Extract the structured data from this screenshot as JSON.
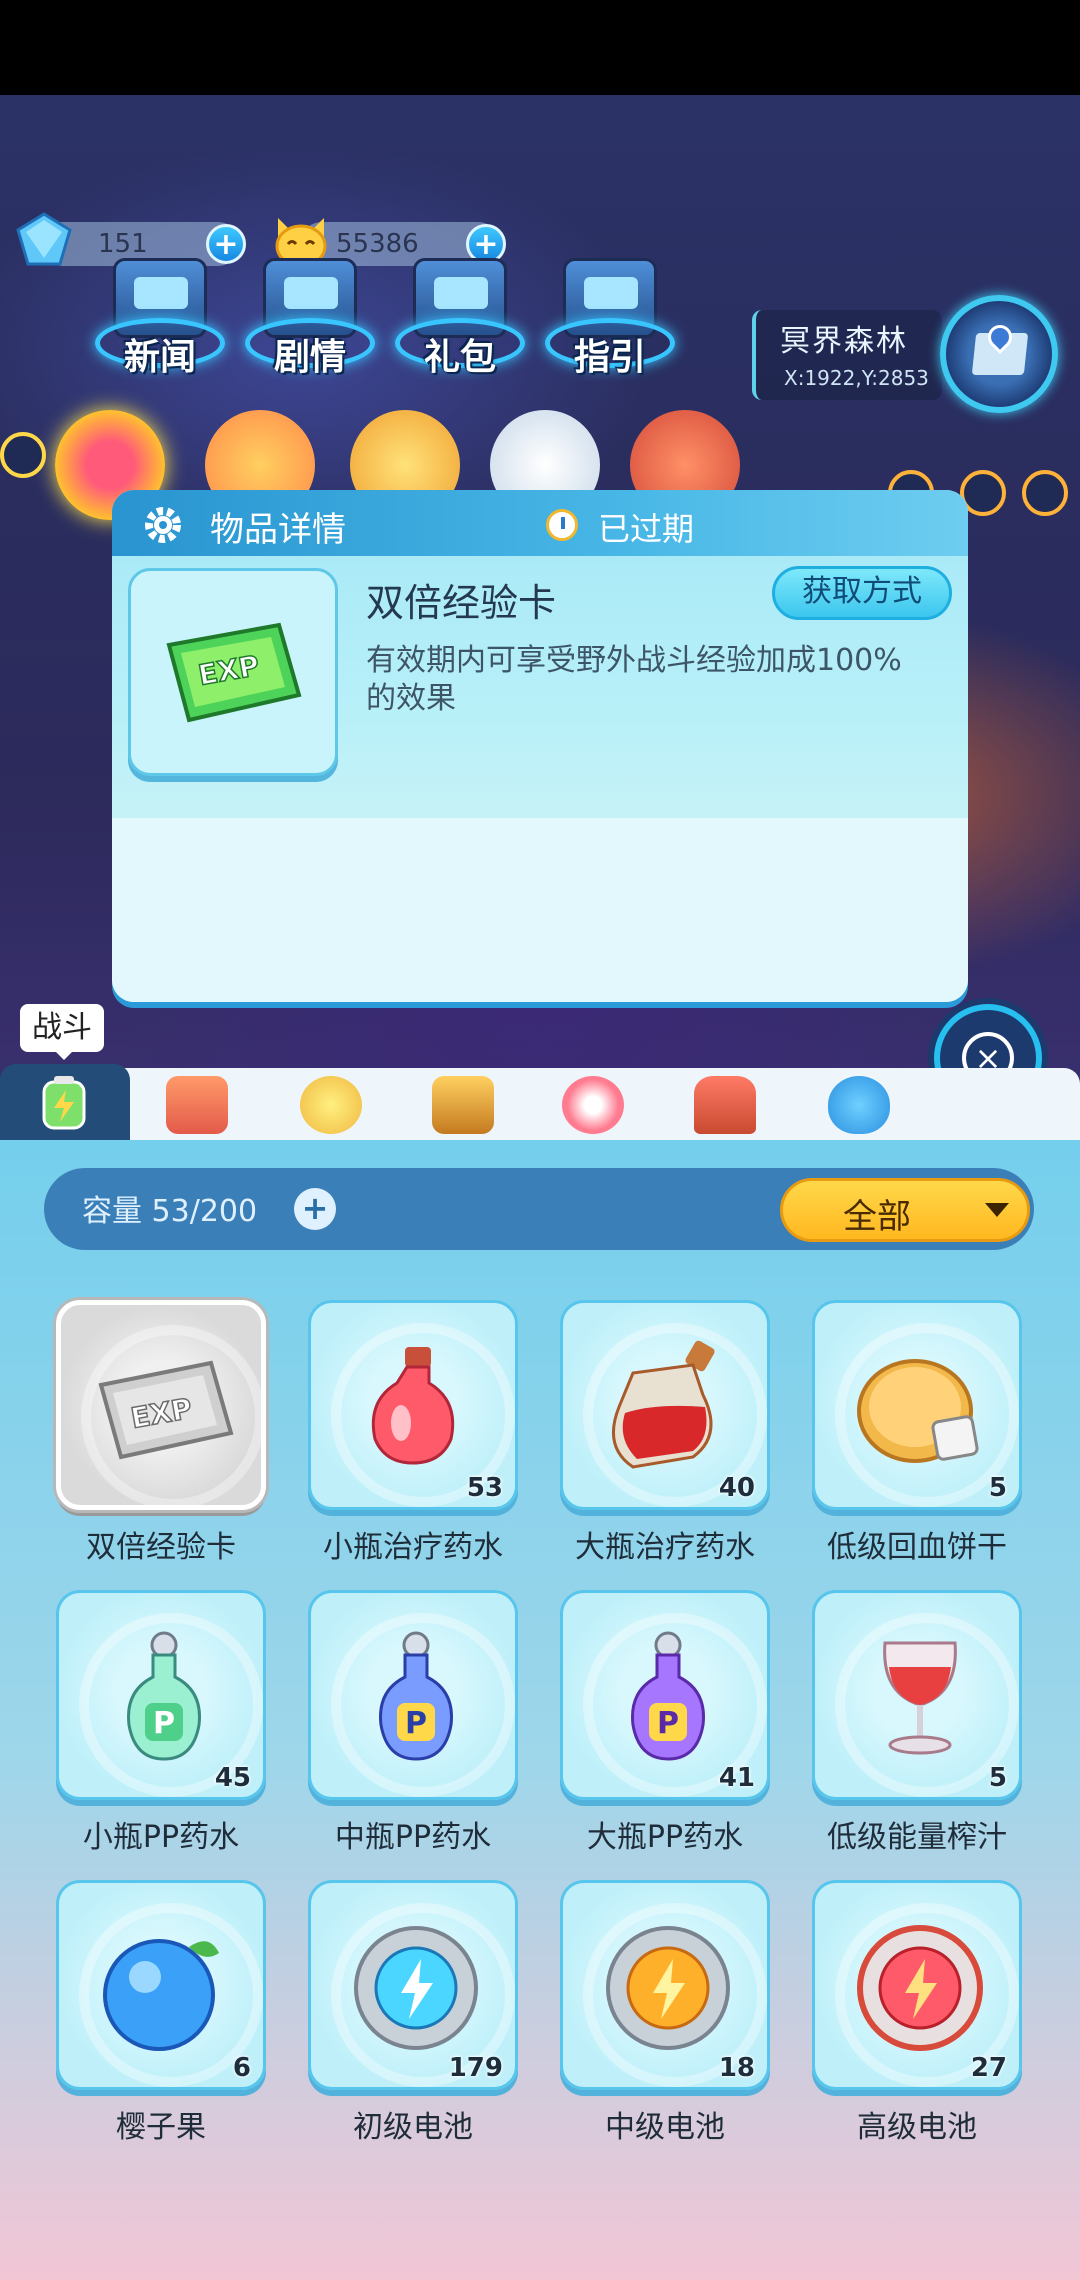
{
  "currency": {
    "gems": "151",
    "coins": "55386",
    "plus_label": "+"
  },
  "menu": {
    "items": [
      {
        "label": "新闻"
      },
      {
        "label": "剧情"
      },
      {
        "label": "礼包"
      },
      {
        "label": "指引"
      }
    ]
  },
  "location": {
    "name": "冥界森林",
    "coords": "X:1922,Y:2853"
  },
  "popup": {
    "title": "物品详情",
    "status": "已过期",
    "item_name": "双倍经验卡",
    "get_button": "获取方式",
    "description": "有效期内可享受野外战斗经验加成100%的效果",
    "close_icon": "×"
  },
  "tab_tip": "战斗",
  "bag": {
    "capacity_label": "容量 53/200",
    "capacity_plus": "+",
    "filter_label": "全部"
  },
  "items": [
    {
      "name": "双倍经验卡",
      "count": "",
      "icon": "exp-card-gray",
      "selected": true
    },
    {
      "name": "小瓶治疗药水",
      "count": "53",
      "icon": "red-potion-small"
    },
    {
      "name": "大瓶治疗药水",
      "count": "40",
      "icon": "red-potion-large"
    },
    {
      "name": "低级回血饼干",
      "count": "5",
      "icon": "biscuit"
    },
    {
      "name": "小瓶PP药水",
      "count": "45",
      "icon": "pp-potion-green"
    },
    {
      "name": "中瓶PP药水",
      "count": "",
      "icon": "pp-potion-blue"
    },
    {
      "name": "大瓶PP药水",
      "count": "41",
      "icon": "pp-potion-purple"
    },
    {
      "name": "低级能量榨汁",
      "count": "5",
      "icon": "juice-glass"
    },
    {
      "name": "樱子果",
      "count": "6",
      "icon": "blue-fruit"
    },
    {
      "name": "初级电池",
      "count": "179",
      "icon": "battery-blue"
    },
    {
      "name": "中级电池",
      "count": "18",
      "icon": "battery-orange"
    },
    {
      "name": "高级电池",
      "count": "27",
      "icon": "battery-red"
    }
  ],
  "colors": {
    "accent": "#3cc6ee",
    "header_blue": "#2994d0",
    "filter_yellow": "#ffc830",
    "panel_blue": "#3b7fb8"
  }
}
